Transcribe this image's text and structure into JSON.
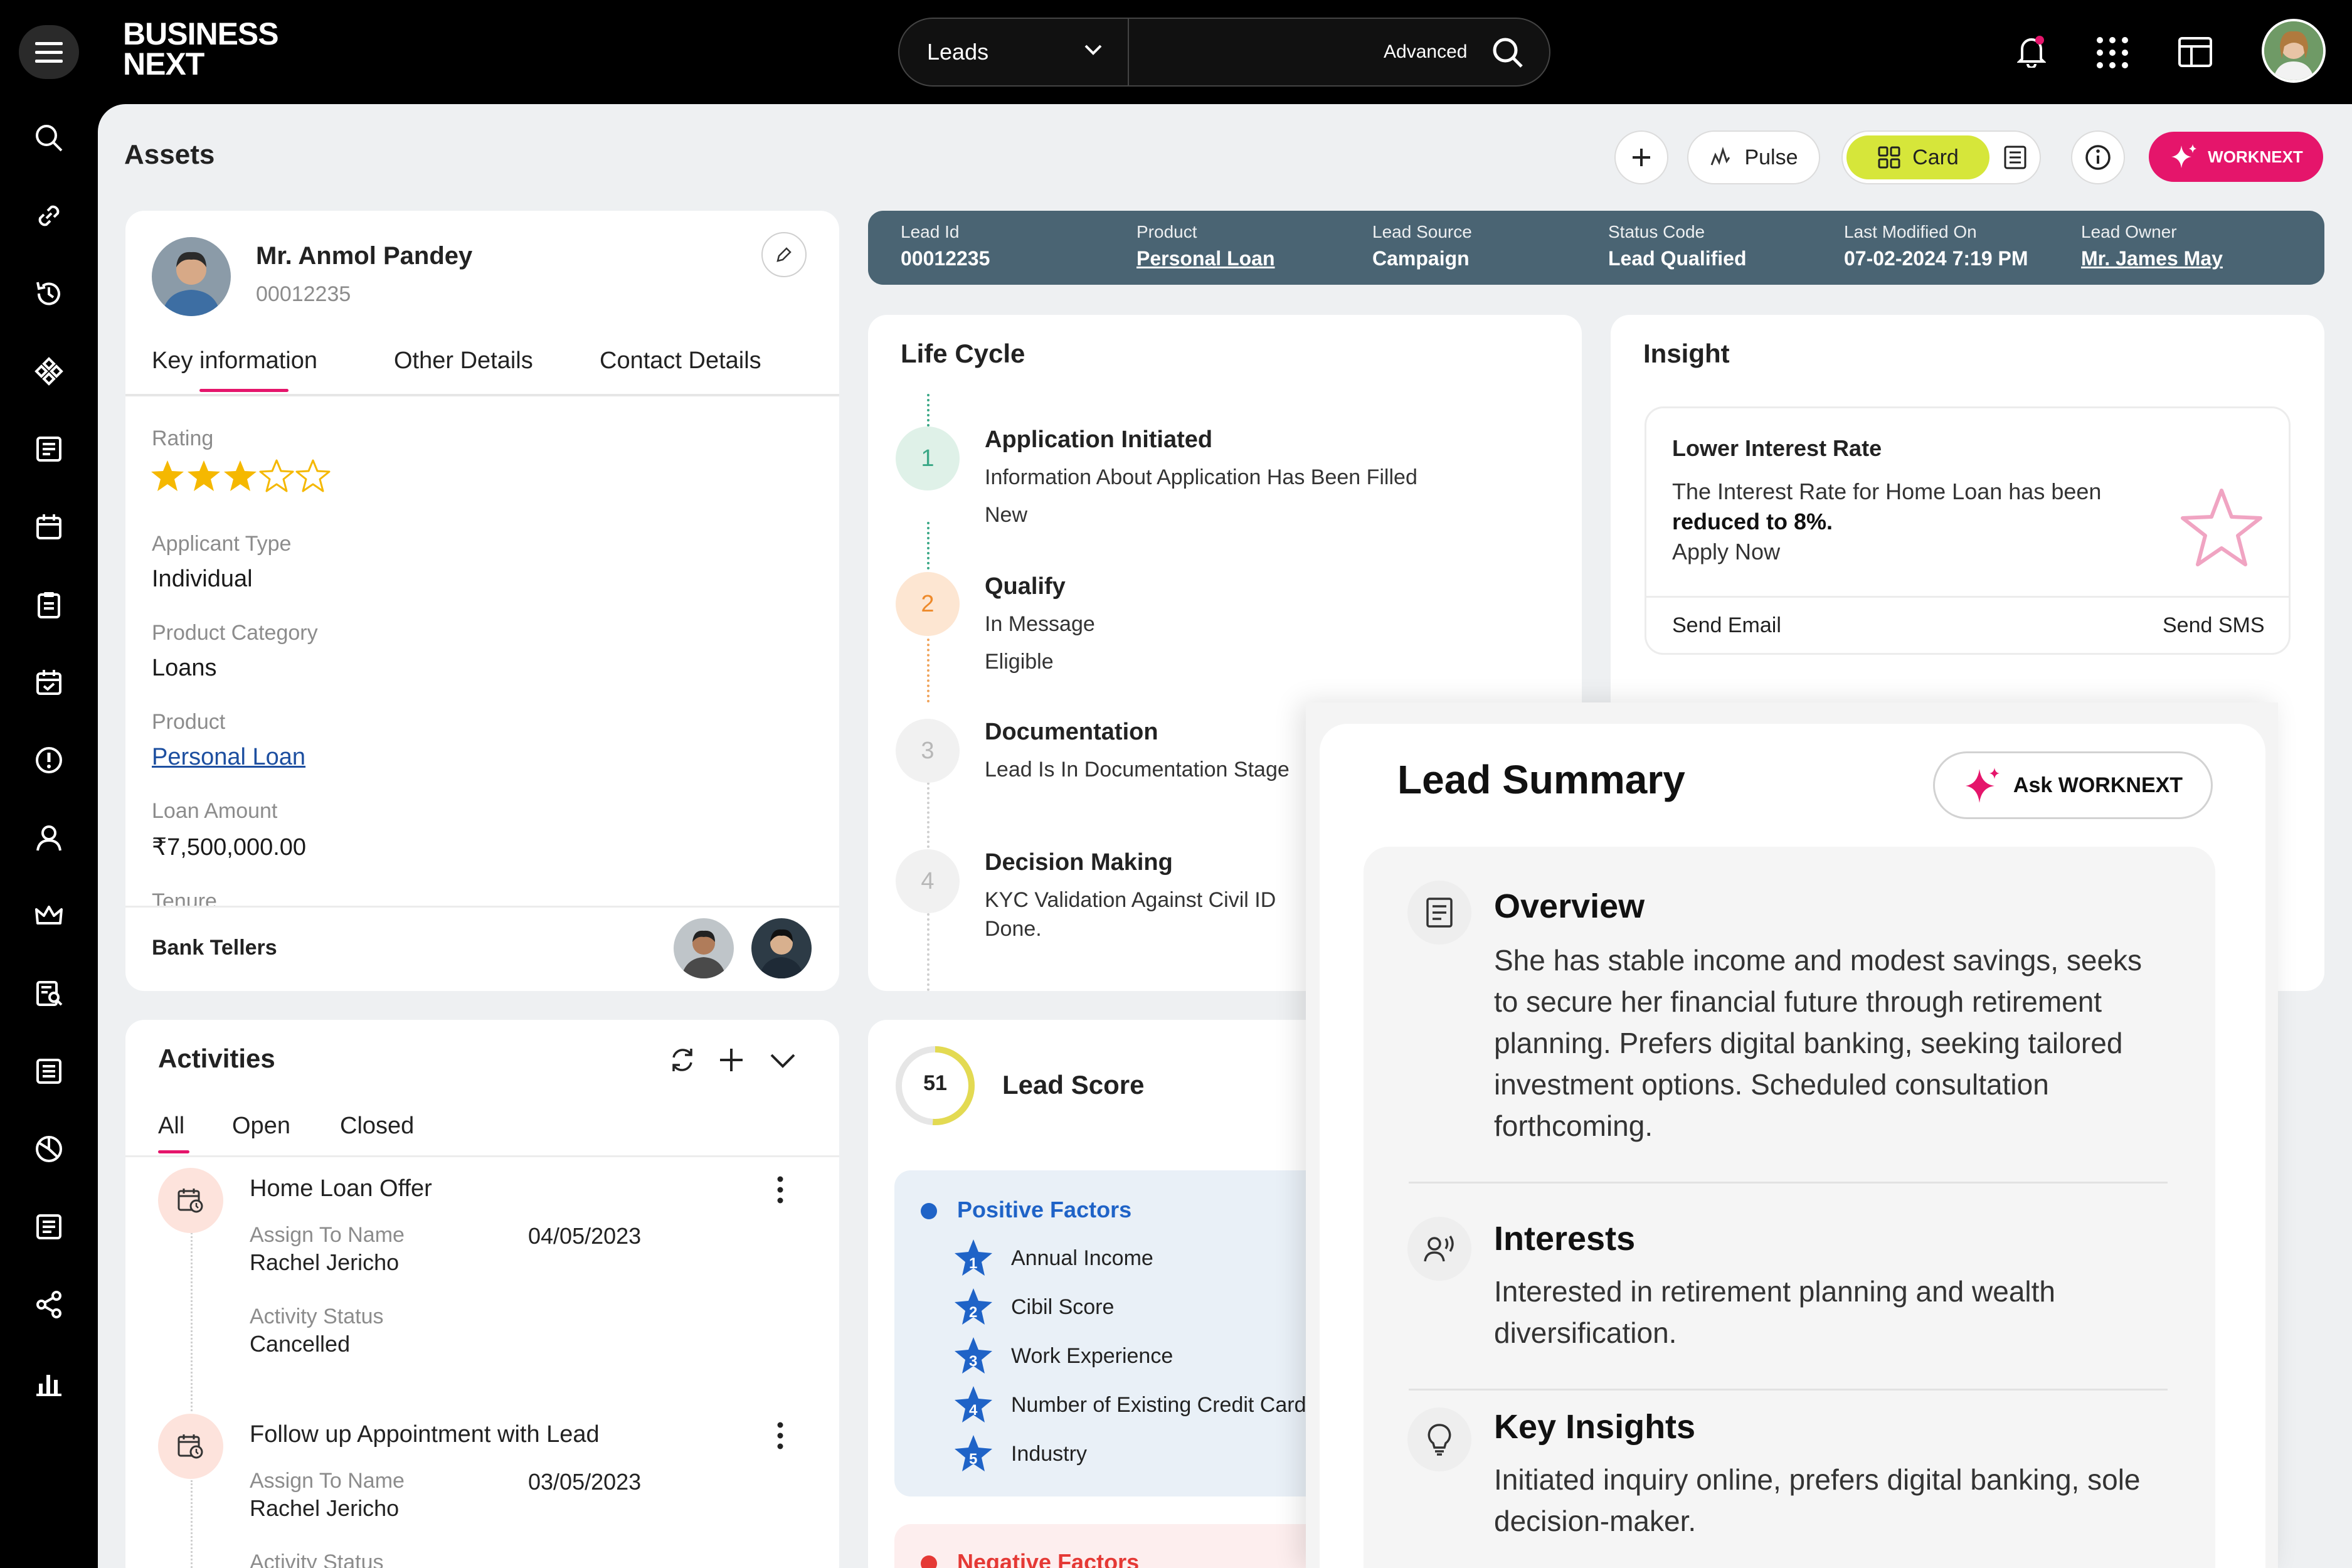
{
  "header": {
    "brand_line1": "BUSINESS",
    "brand_line2": "NEXT",
    "module_select": "Leads",
    "advanced_label": "Advanced"
  },
  "page": {
    "title": "Assets"
  },
  "toolbar": {
    "pulse_label": "Pulse",
    "card_label": "Card",
    "worknext_label": "WORKNEXT"
  },
  "profile": {
    "name": "Mr. Anmol Pandey",
    "id": "00012235",
    "tabs": [
      "Key information",
      "Other Details",
      "Contact Details"
    ],
    "fields": [
      {
        "label": "Rating",
        "value": "3 of 5 stars"
      },
      {
        "label": "Applicant Type",
        "value": "Individual"
      },
      {
        "label": "Product Category",
        "value": "Loans"
      },
      {
        "label": "Product",
        "value": "Personal Loan"
      },
      {
        "label": "Loan Amount",
        "value": "₹7,500,000.00"
      },
      {
        "label": "Tenure",
        "value": ""
      }
    ],
    "rating_value": 3,
    "rating_max": 5,
    "bank_tellers_label": "Bank Tellers"
  },
  "lead_info": [
    {
      "label": "Lead Id",
      "value": "00012235"
    },
    {
      "label": "Product",
      "value": "Personal Loan"
    },
    {
      "label": "Lead Source",
      "value": "Campaign"
    },
    {
      "label": "Status Code",
      "value": "Lead Qualified"
    },
    {
      "label": "Last Modified On",
      "value": "07-02-2024 7:19 PM"
    },
    {
      "label": "Lead Owner",
      "value": "Mr. James May"
    }
  ],
  "lifecycle": {
    "title": "Life Cycle",
    "steps": [
      {
        "num": "1",
        "title": "Application Initiated",
        "line1": "Information About Application Has Been Filled",
        "line2": "New"
      },
      {
        "num": "2",
        "title": "Qualify",
        "line1": "In Message",
        "line2": "Eligible"
      },
      {
        "num": "3",
        "title": "Documentation",
        "line1": "Lead Is In Documentation Stage",
        "line2": ""
      },
      {
        "num": "4",
        "title": "Decision Making",
        "line1": "KYC Validation Against Civil ID",
        "line2": "Done."
      }
    ]
  },
  "insight": {
    "title": "Insight",
    "card_title": "Lower Interest Rate",
    "text_pre": "The Interest Rate for Home Loan has been",
    "text_bold": "reduced to 8%.",
    "text_after": "Apply Now",
    "send_email": "Send Email",
    "send_sms": "Send SMS"
  },
  "activities": {
    "title": "Activities",
    "tabs": [
      "All",
      "Open",
      "Closed"
    ],
    "items": [
      {
        "title": "Home Loan Offer",
        "assign_label": "Assign To Name",
        "assign_value": "Rachel Jericho",
        "date": "04/05/2023",
        "status_label": "Activity Status",
        "status_value": "Cancelled"
      },
      {
        "title": "Follow up Appointment with Lead",
        "assign_label": "Assign To Name",
        "assign_value": "Rachel Jericho",
        "date": "03/05/2023",
        "status_label": "Activity Status",
        "status_value": ""
      }
    ]
  },
  "lead_score": {
    "value": "51",
    "score_fraction": 0.51,
    "title": "Lead Score",
    "positive_title": "Positive Factors",
    "positive": [
      {
        "num": "1",
        "label": "Annual Income"
      },
      {
        "num": "2",
        "label": "Cibil Score"
      },
      {
        "num": "3",
        "label": "Work Experience"
      },
      {
        "num": "4",
        "label": "Number of Existing Credit Cards"
      },
      {
        "num": "5",
        "label": "Industry"
      }
    ],
    "negative_title": "Negative Factors"
  },
  "summary": {
    "title": "Lead Summary",
    "ask_label": "Ask WORKNEXT",
    "overview_title": "Overview",
    "overview_lines": [
      "She has stable income and modest savings, seeks",
      "to secure her financial future through retirement",
      "planning. Prefers digital banking, seeking tailored",
      "investment options. Scheduled consultation",
      "forthcoming."
    ],
    "interests_title": "Interests",
    "interests_lines": [
      "Interested in retirement planning and wealth",
      "diversification."
    ],
    "insights_title": "Key Insights",
    "insights_lines": [
      "Initiated inquiry online, prefers digital banking, sole",
      "decision-maker."
    ]
  },
  "colors": {
    "accent": "#e5156b",
    "header_bar": "#4a6473",
    "card_toggle": "#d6e63a",
    "step1": "#dff1e8",
    "step2": "#fde6d2"
  }
}
